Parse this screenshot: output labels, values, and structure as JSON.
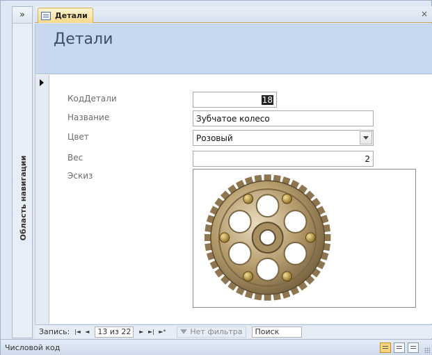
{
  "nav_pane": {
    "toggle": "»",
    "label": "Область навигации"
  },
  "tab": {
    "title": "Детали",
    "close": "×"
  },
  "form": {
    "title": "Детали",
    "fields": {
      "id": {
        "label": "КодДетали",
        "value": "18"
      },
      "name": {
        "label": "Название",
        "value": "Зубчатое колесо"
      },
      "color": {
        "label": "Цвет",
        "value": "Розовый"
      },
      "weight": {
        "label": "Вес",
        "value": "2"
      },
      "sketch": {
        "label": "Эскиз",
        "image": "gear-image"
      }
    }
  },
  "record_nav": {
    "label": "Запись:",
    "first": "|◄",
    "prev": "◄",
    "current": "13 из 22",
    "next": "►",
    "last": "►|",
    "new": "►*",
    "filter": "Нет фильтра",
    "search": "Поиск"
  },
  "status": {
    "text": "Числовой код"
  },
  "colors": {
    "header": "#c8d8ee",
    "tab": "#f8d98a",
    "gear": "#b49a6a"
  }
}
